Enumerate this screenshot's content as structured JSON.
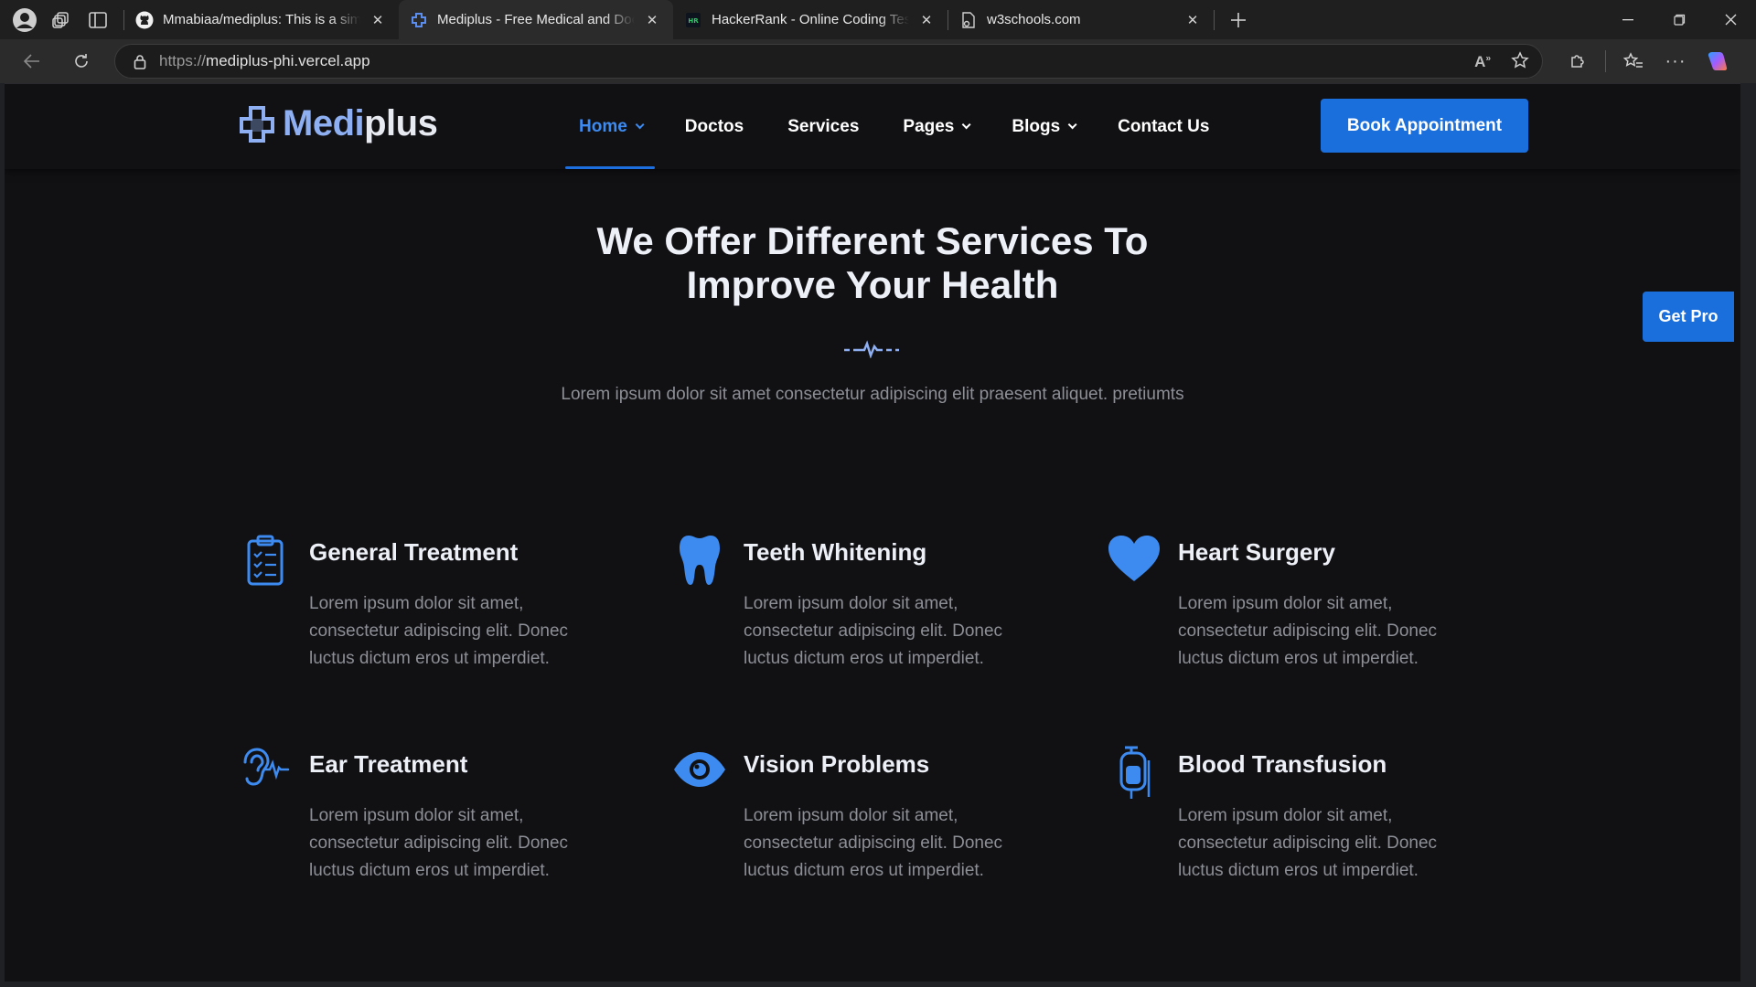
{
  "browser": {
    "tabs": [
      {
        "title": "Mmabiaa/mediplus: This is a simple",
        "favicon": "github-icon"
      },
      {
        "title": "Mediplus - Free Medical and Doctor",
        "favicon": "mediplus-icon"
      },
      {
        "title": "HackerRank - Online Coding Tests",
        "favicon": "hackerrank-icon"
      },
      {
        "title": "w3schools.com",
        "favicon": "page-icon"
      }
    ],
    "url_protocol": "https://",
    "url_host": "mediplus-phi.vercel.app"
  },
  "site": {
    "logo_pre": "Medi",
    "logo_post": "plus",
    "nav": [
      {
        "label": "Home"
      },
      {
        "label": "Doctos"
      },
      {
        "label": "Services"
      },
      {
        "label": "Pages"
      },
      {
        "label": "Blogs"
      },
      {
        "label": "Contact Us"
      }
    ],
    "book_button": "Book Appointment",
    "get_pro": "Get Pro"
  },
  "section": {
    "title_line1": "We Offer Different Services To",
    "title_line2": "Improve Your Health",
    "subtitle": "Lorem ipsum dolor sit amet consectetur adipiscing elit praesent aliquet. pretiumts",
    "services": [
      {
        "title": "General Treatment",
        "icon": "clipboard-icon",
        "desc": "Lorem ipsum dolor sit amet, consectetur adipiscing elit. Donec luctus dictum eros ut imperdiet."
      },
      {
        "title": "Teeth Whitening",
        "icon": "tooth-icon",
        "desc": "Lorem ipsum dolor sit amet, consectetur adipiscing elit. Donec luctus dictum eros ut imperdiet."
      },
      {
        "title": "Heart Surgery",
        "icon": "heart-icon",
        "desc": "Lorem ipsum dolor sit amet, consectetur adipiscing elit. Donec luctus dictum eros ut imperdiet."
      },
      {
        "title": "Ear Treatment",
        "icon": "ear-icon",
        "desc": "Lorem ipsum dolor sit amet, consectetur adipiscing elit. Donec luctus dictum eros ut imperdiet."
      },
      {
        "title": "Vision Problems",
        "icon": "eye-icon",
        "desc": "Lorem ipsum dolor sit amet, consectetur adipiscing elit. Donec luctus dictum eros ut imperdiet."
      },
      {
        "title": "Blood Transfusion",
        "icon": "blood-bag-icon",
        "desc": "Lorem ipsum dolor sit amet, consectetur adipiscing elit. Donec luctus dictum eros ut imperdiet."
      }
    ]
  },
  "colors": {
    "accent": "#1a6fdc",
    "icon_blue": "#3d8bf0",
    "page_bg": "#111114"
  }
}
